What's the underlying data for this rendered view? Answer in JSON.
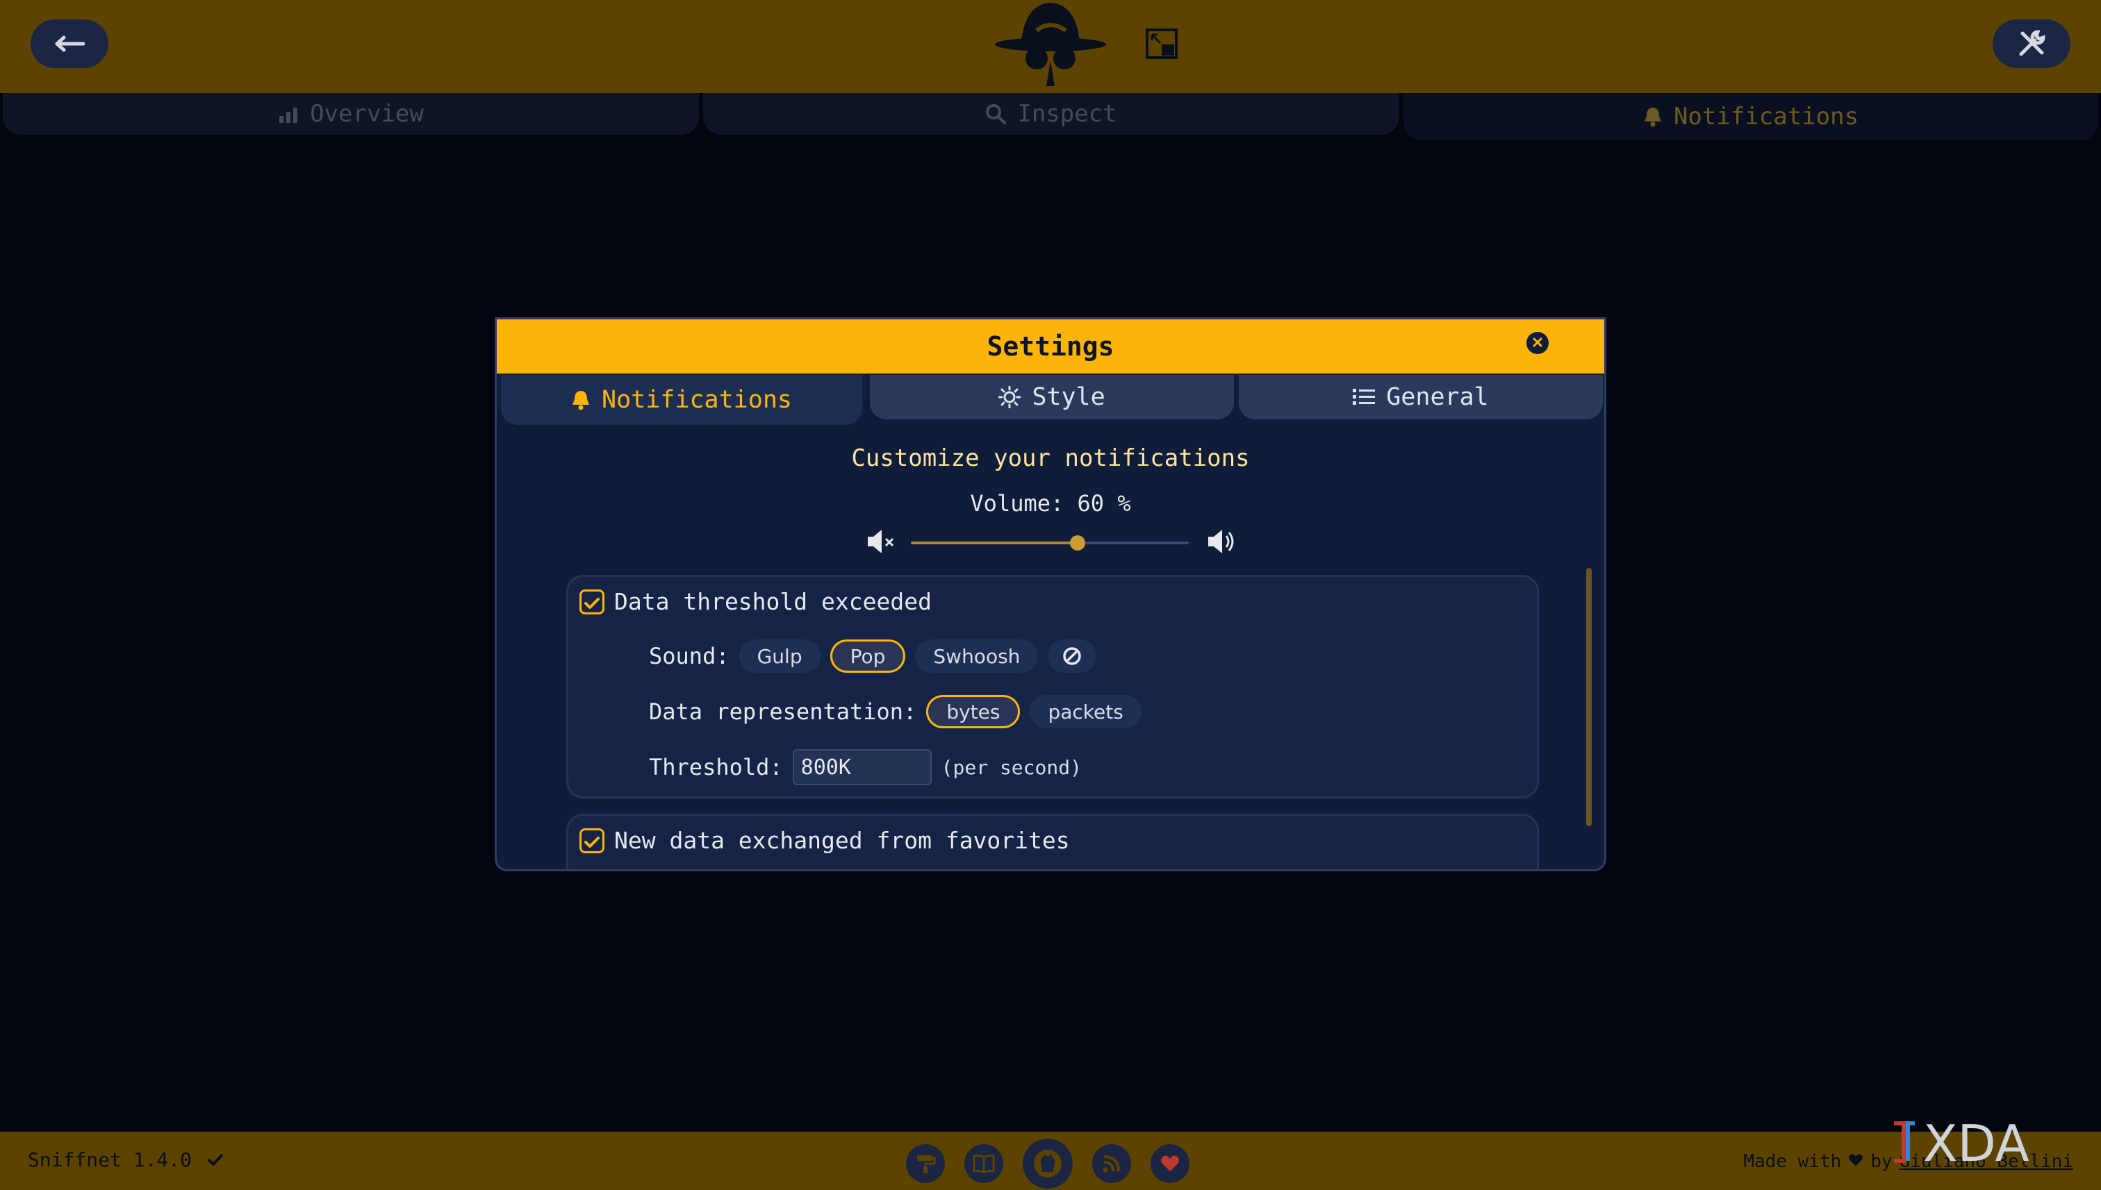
{
  "header": {
    "back_icon": "arrow-left-icon",
    "logo_icon": "spy-hat-logo-icon",
    "pip_icon": "picture-in-picture-icon",
    "settings_icon": "wrench-screwdriver-icon"
  },
  "top_tabs": [
    {
      "label": "Overview",
      "icon": "chart-icon"
    },
    {
      "label": "Inspect",
      "icon": "magnifier-icon"
    },
    {
      "label": "Notifications",
      "icon": "bell-icon"
    }
  ],
  "modal": {
    "title": "Settings",
    "tabs": [
      {
        "label": "Notifications",
        "icon": "bell-icon"
      },
      {
        "label": "Style",
        "icon": "sun-icon"
      },
      {
        "label": "General",
        "icon": "list-icon"
      }
    ],
    "subtitle": "Customize your notifications",
    "volume_label": "Volume: 60 %",
    "volume_value": 60,
    "cards": [
      {
        "title": "Data threshold exceeded",
        "checked": true,
        "sound_label": "Sound:",
        "sounds": [
          "Gulp",
          "Pop",
          "Swhoosh"
        ],
        "selected_sound": "Pop",
        "data_repr_label": "Data representation:",
        "data_reprs": [
          "bytes",
          "packets"
        ],
        "selected_repr": "bytes",
        "threshold_label": "Threshold:",
        "threshold_value": "800K",
        "threshold_unit": "(per second)"
      },
      {
        "title": "New data exchanged from favorites",
        "checked": true
      }
    ]
  },
  "footer": {
    "version": "Sniffnet 1.4.0",
    "made_with": "Made with",
    "by": "by",
    "author": "Giuliano Bellini",
    "icons": [
      "paint-roller-icon",
      "book-icon",
      "github-icon",
      "rss-icon",
      "heart-icon"
    ]
  },
  "watermark": "XDA",
  "colors": {
    "accent": "#fdb408",
    "header_bg": "#5c4400",
    "page_bg": "#03050f",
    "modal_bg": "#0f1d3b"
  }
}
